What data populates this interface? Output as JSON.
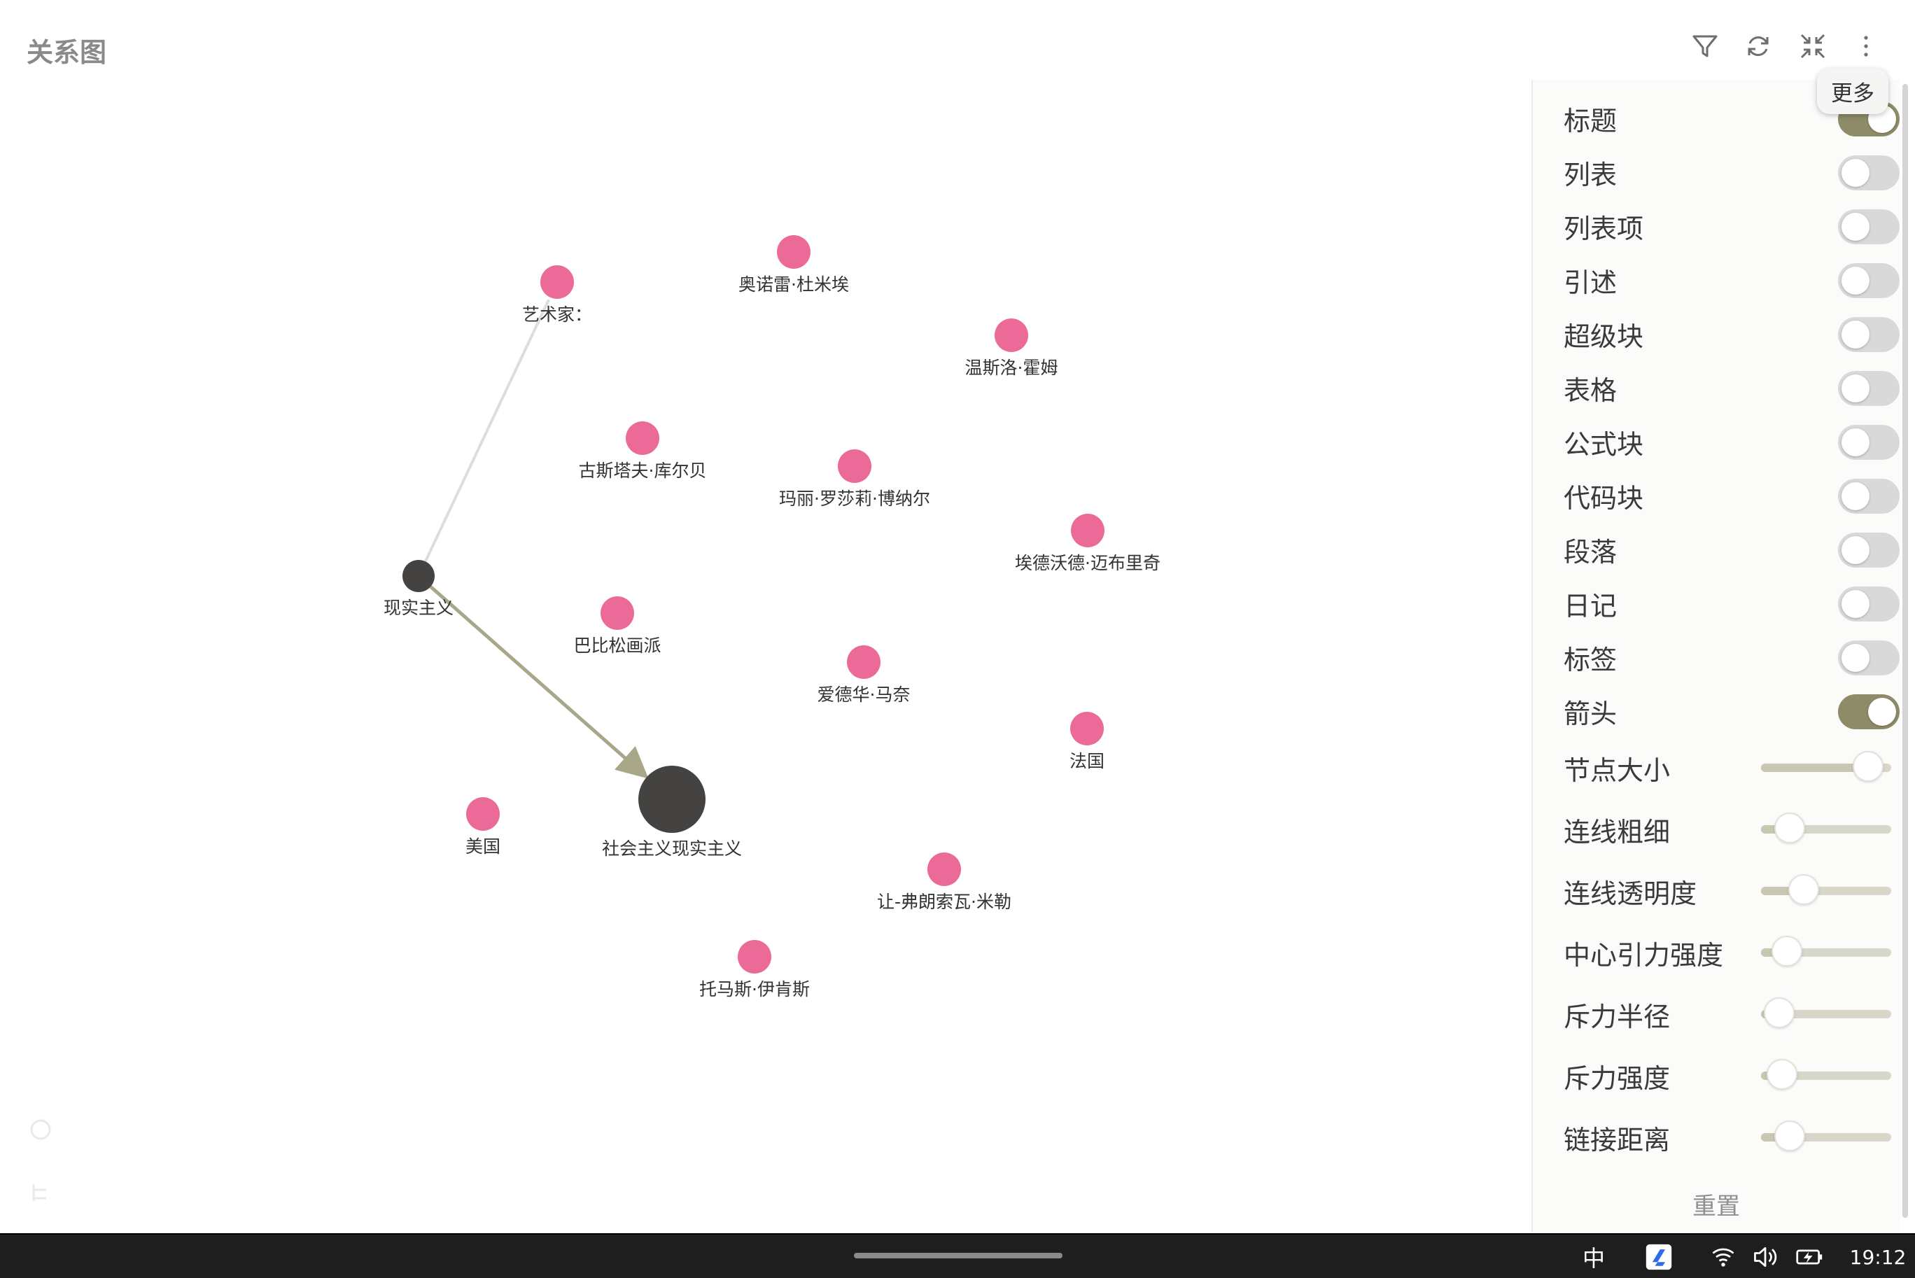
{
  "app": {
    "title": "关系图"
  },
  "toolbar": {
    "icons": [
      "filter-icon",
      "refresh-icon",
      "collapse-icon",
      "more-icon"
    ],
    "tooltip": "更多"
  },
  "graph": {
    "nodes": [
      {
        "label": "艺术家："
      },
      {
        "label": "奥诺雷·杜米埃"
      },
      {
        "label": "温斯洛·霍姆"
      },
      {
        "label": "古斯塔夫·库尔贝"
      },
      {
        "label": "玛丽·罗莎莉·博纳尔"
      },
      {
        "label": "埃德沃德·迈布里奇"
      },
      {
        "label": "现实主义"
      },
      {
        "label": "巴比松画派"
      },
      {
        "label": "爱德华·马奈"
      },
      {
        "label": "法国"
      },
      {
        "label": "美国"
      },
      {
        "label": "社会主义现实主义"
      },
      {
        "label": "让-弗朗索瓦·米勒"
      },
      {
        "label": "托马斯·伊肯斯"
      }
    ],
    "links": [
      {
        "source": "现实主义",
        "target": "艺术家：",
        "arrow": false
      },
      {
        "source": "现实主义",
        "target": "社会主义现实主义",
        "arrow": true
      }
    ]
  },
  "panel": {
    "toggles": [
      {
        "label": "标题",
        "on": true
      },
      {
        "label": "列表",
        "on": false
      },
      {
        "label": "列表项",
        "on": false
      },
      {
        "label": "引述",
        "on": false
      },
      {
        "label": "超级块",
        "on": false
      },
      {
        "label": "表格",
        "on": false
      },
      {
        "label": "公式块",
        "on": false
      },
      {
        "label": "代码块",
        "on": false
      },
      {
        "label": "段落",
        "on": false
      },
      {
        "label": "日记",
        "on": false
      },
      {
        "label": "标签",
        "on": false
      },
      {
        "label": "箭头",
        "on": true
      }
    ],
    "sliders": [
      {
        "label": "节点大小",
        "value": 0.82
      },
      {
        "label": "连线粗细",
        "value": 0.22
      },
      {
        "label": "连线透明度",
        "value": 0.33
      },
      {
        "label": "中心引力强度",
        "value": 0.2
      },
      {
        "label": "斥力半径",
        "value": 0.14
      },
      {
        "label": "斥力强度",
        "value": 0.16
      },
      {
        "label": "链接距离",
        "value": 0.22
      }
    ],
    "reset_label": "重置"
  },
  "taskbar": {
    "ime": "中",
    "time": "19:12"
  },
  "colors": {
    "node_pink": "#ec6a97",
    "node_dark": "#454341",
    "link_arrow": "#a9a78a",
    "link_plain": "#dddddd",
    "toggle_on": "#8e8c68"
  }
}
